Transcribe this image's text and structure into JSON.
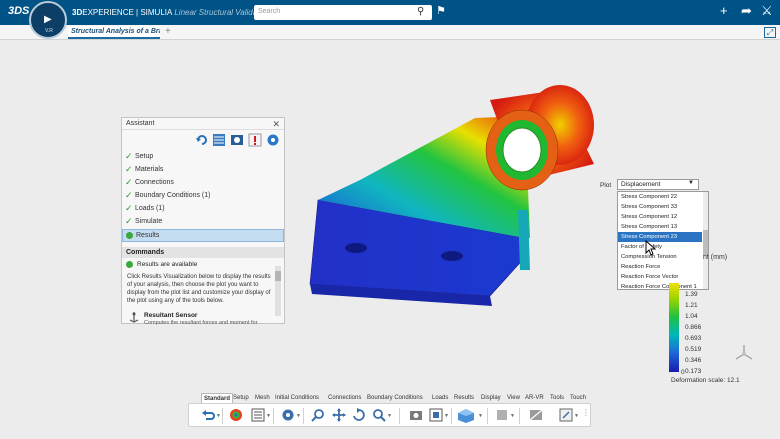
{
  "header": {
    "logo": "3DS",
    "brand_prefix": "3D",
    "brand_main": "EXPERIENCE | SIMULIA",
    "app_name": "Linear Structural Validation",
    "search_placeholder": "Search",
    "compass_version": "V.R"
  },
  "tab": {
    "label": "Structural Analysis of a Bra"
  },
  "assistant": {
    "title": "Assistant",
    "steps": [
      {
        "label": "Setup"
      },
      {
        "label": "Materials"
      },
      {
        "label": "Connections"
      },
      {
        "label": "Boundary Conditions (1)"
      },
      {
        "label": "Loads (1)"
      },
      {
        "label": "Simulate"
      },
      {
        "label": "Results"
      }
    ],
    "commands_title": "Commands",
    "status": "Results are available",
    "description": "Click Results Visualization below to display the results of your analysis, then choose the plot you want to display from the plot list and customize your display of the plot using any of the tools below.",
    "sensor_title": "Resultant Sensor",
    "sensor_desc": "Computes the resultant forces and moment for"
  },
  "plot": {
    "label": "Plot",
    "selected": "Displacement",
    "options": [
      "Stress Component 22",
      "Stress Component 33",
      "Stress Component 12",
      "Stress Component 13",
      "Stress Component 23",
      "Factor of Safety",
      "Compression Tension",
      "Reaction Force",
      "Reaction Force Vector",
      "Reaction Force Component 1"
    ],
    "highlighted_index": 4
  },
  "legend": {
    "unit_label": "nt (mm)",
    "values": [
      "1.39",
      "1.21",
      "1.04",
      "0.866",
      "0.693",
      "0.519",
      "0.346",
      "0.173",
      "0"
    ],
    "deformation": "Deformation scale: 12.1"
  },
  "command_tabs": [
    "Standard",
    "Setup",
    "Mesh",
    "Initial Conditions",
    "Connections",
    "Boundary Conditions",
    "Loads",
    "Results",
    "Display",
    "View",
    "AR-VR",
    "Tools",
    "Touch"
  ],
  "colors": {
    "header": "#005386",
    "accent": "#2b74c3",
    "check": "#2e9a2e"
  }
}
